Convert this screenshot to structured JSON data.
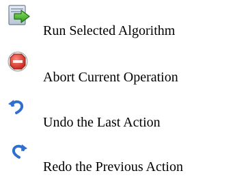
{
  "legend": {
    "items": [
      {
        "icon": "run-arrow-icon",
        "label": "Run Selected Algorithm"
      },
      {
        "icon": "stop-sign-icon",
        "label": "Abort Current Operation"
      },
      {
        "icon": "undo-arrow-icon",
        "label": "Undo the Last Action"
      },
      {
        "icon": "redo-arrow-icon",
        "label": "Redo the Previous Action"
      }
    ]
  },
  "colors": {
    "run_green": "#3fae2a",
    "stop_red": "#e0453a",
    "undo_blue": "#2f6fd0",
    "redo_blue": "#2f6fd0"
  }
}
